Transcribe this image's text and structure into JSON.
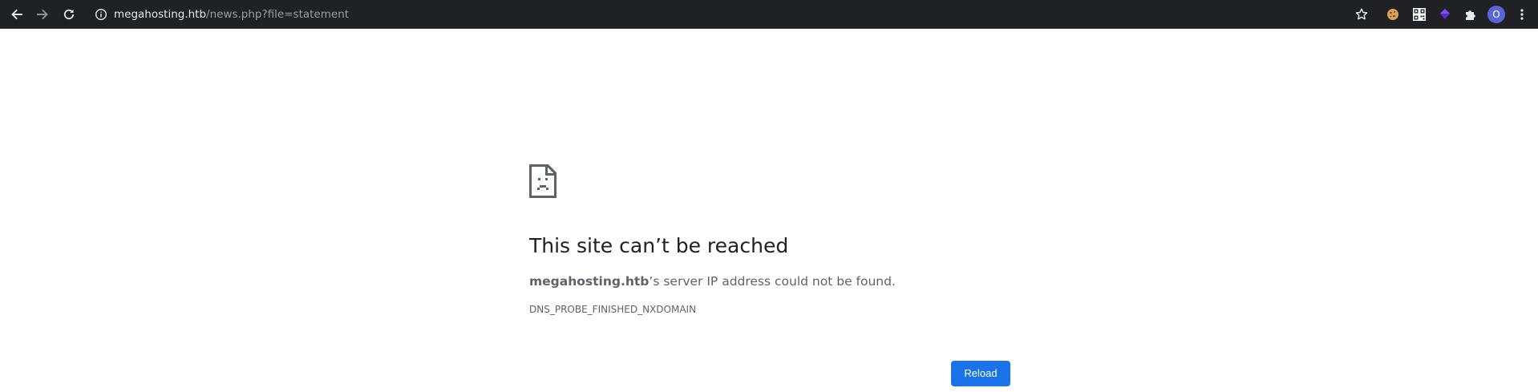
{
  "browser": {
    "url": {
      "host": "megahosting.htb",
      "path": "/news.php?file=statement"
    },
    "profile_initial": "O",
    "icons": {
      "back": "back-arrow-icon",
      "forward": "forward-arrow-icon",
      "reload": "reload-icon",
      "site_info": "info-icon",
      "bookmark": "star-icon",
      "extensions": [
        "cookie-icon",
        "qr-code-icon",
        "purple-diamond-icon",
        "puzzle-icon"
      ],
      "menu": "kebab-menu-icon"
    },
    "colors": {
      "toolbar_bg": "#202124",
      "url_host": "#e8eaed",
      "url_path": "#9aa0a6",
      "profile_bg": "#5865d6"
    }
  },
  "error_page": {
    "icon": "sad-page-icon",
    "title": "This site can’t be reached",
    "description_host": "megahosting.htb",
    "description_rest": "’s server IP address could not be found.",
    "error_code": "DNS_PROBE_FINISHED_NXDOMAIN",
    "reload_label": "Reload",
    "colors": {
      "title": "#202124",
      "text": "#5f6368",
      "button": "#1a73e8"
    }
  }
}
